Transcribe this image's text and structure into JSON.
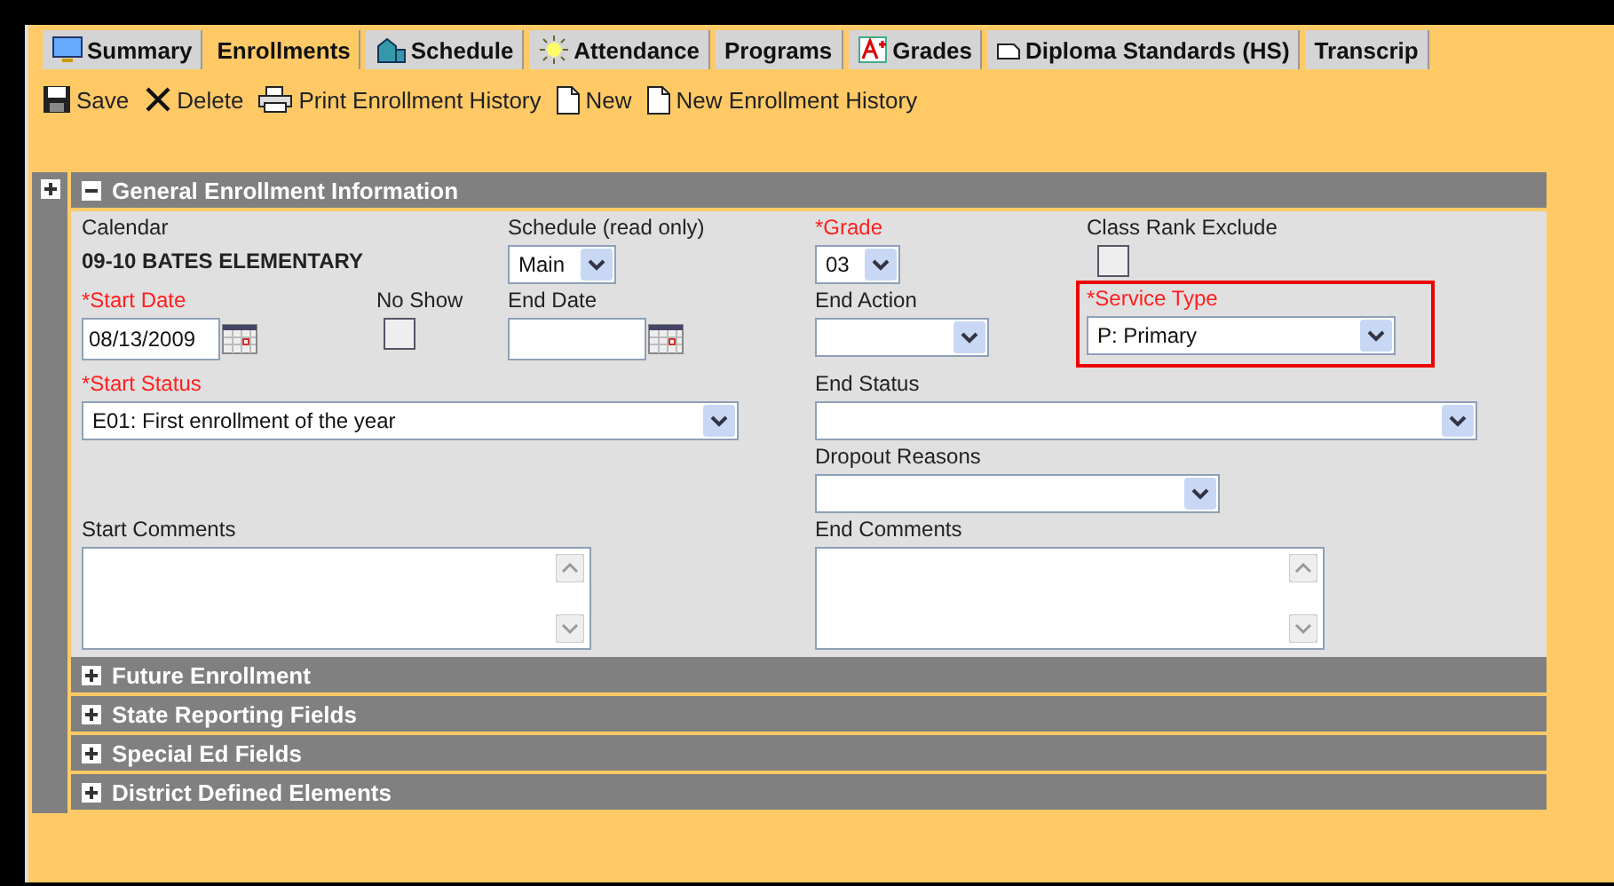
{
  "tabs": [
    {
      "label": "Summary",
      "kind": "monitor",
      "selected": false
    },
    {
      "label": "Enrollments",
      "kind": "plain",
      "selected": true
    },
    {
      "label": "Schedule",
      "kind": "building",
      "selected": false
    },
    {
      "label": "Attendance",
      "kind": "sun",
      "selected": false
    },
    {
      "label": "Programs",
      "kind": "plain",
      "selected": false
    },
    {
      "label": "Grades",
      "kind": "grade",
      "selected": false
    },
    {
      "label": "Diploma Standards (HS)",
      "kind": "document",
      "selected": false
    },
    {
      "label": "Transcrip",
      "kind": "plain",
      "selected": false
    }
  ],
  "toolbar": [
    {
      "label": "Save",
      "kind": "save"
    },
    {
      "label": "Delete",
      "kind": "delete"
    },
    {
      "label": "Print Enrollment History",
      "kind": "print"
    },
    {
      "label": "New",
      "kind": "new"
    },
    {
      "label": "New Enrollment History",
      "kind": "new"
    }
  ],
  "general": {
    "title": "General Enrollment Information",
    "expanded": true,
    "calendar": {
      "label": "Calendar",
      "value": "09-10 BATES ELEMENTARY"
    },
    "schedule": {
      "label": "Schedule (read only)",
      "value": "Main"
    },
    "grade": {
      "label": "*Grade",
      "required": true,
      "value": "03"
    },
    "class_rank_exclude": {
      "label": "Class Rank Exclude",
      "checked": false
    },
    "start_date": {
      "label": "*Start Date",
      "required": true,
      "value": "08/13/2009"
    },
    "no_show": {
      "label": "No Show",
      "checked": false
    },
    "end_date": {
      "label": "End Date",
      "required": false
    },
    "end_action": {
      "label": "End Action",
      "required": false
    },
    "service_type": {
      "label": "*Service Type",
      "required": true,
      "value": "P: Primary",
      "highlighted": true
    },
    "start_status": {
      "label": "*Start Status",
      "required": true,
      "value": "E01: First enrollment of the year"
    },
    "end_status": {
      "label": "End Status",
      "required": false
    },
    "dropout_reasons": {
      "label": "Dropout Reasons",
      "required": false
    },
    "start_comments": {
      "label": "Start Comments"
    },
    "end_comments": {
      "label": "End Comments"
    }
  },
  "sections": [
    {
      "title": "Future Enrollment",
      "expanded": false
    },
    {
      "title": "State Reporting Fields",
      "expanded": false
    },
    {
      "title": "Special Ed Fields",
      "expanded": false
    },
    {
      "title": "District Defined Elements",
      "expanded": false
    }
  ]
}
